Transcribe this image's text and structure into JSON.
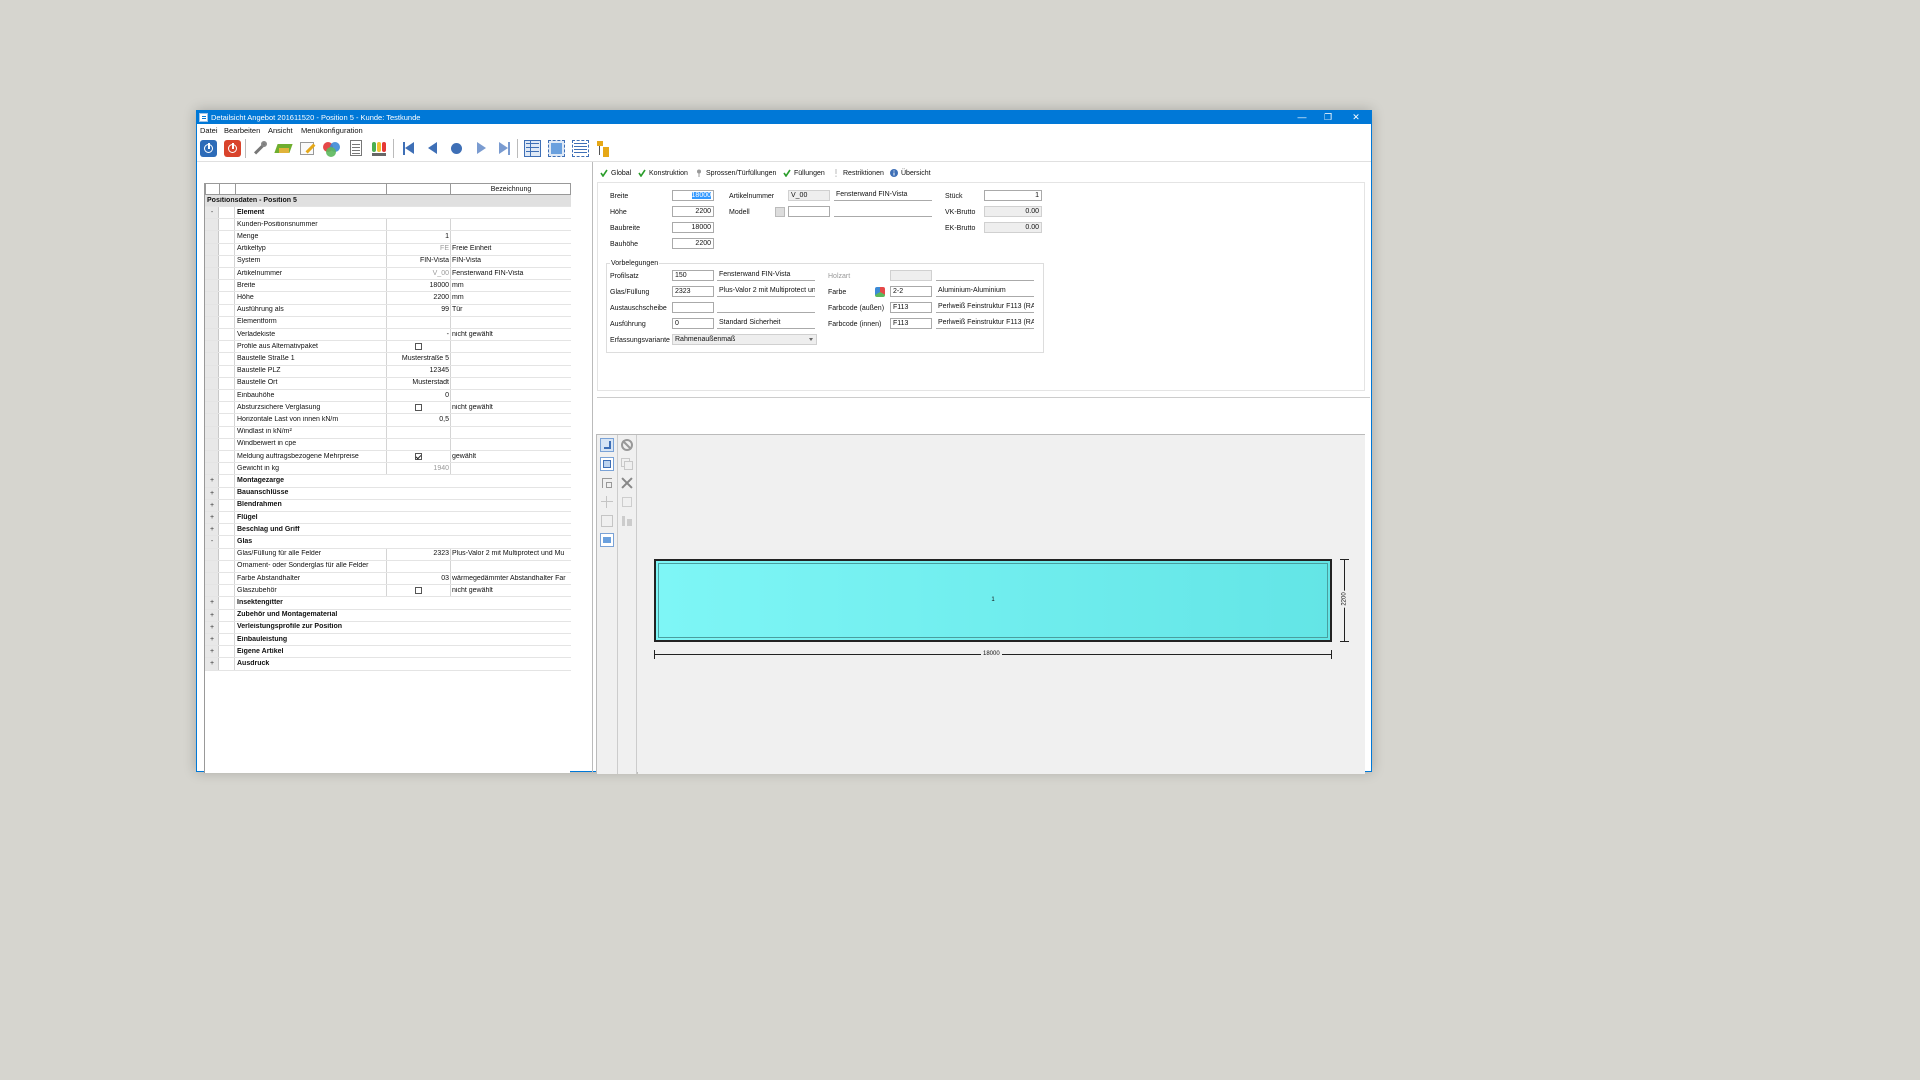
{
  "window": {
    "title": "Detailsicht Angebot 201611520 - Position 5 - Kunde: Testkunde",
    "min": "—",
    "restore": "❐",
    "close": "✕"
  },
  "menu": [
    "Datei",
    "Bearbeiten",
    "Ansicht",
    "Menükonfiguration"
  ],
  "toolbar": {
    "icons": [
      "power-blue-icon",
      "power-red-icon",
      "tools-icon",
      "arrow-green-icon",
      "pencil-icon",
      "palette-icon",
      "document-icon",
      "traffic-light-icon",
      "first-record-icon",
      "previous-record-icon",
      "current-record-icon",
      "next-record-icon",
      "last-record-icon",
      "grid-view-icon",
      "window-view-icon",
      "table-view-icon",
      "tree-view-icon"
    ]
  },
  "grid": {
    "header_bezeichnung": "Bezeichnung",
    "section_title": "Positionsdaten - Position 5",
    "rows": [
      {
        "pm": "-",
        "name": "Element",
        "value": "",
        "desc": "",
        "group": true
      },
      {
        "pm": "",
        "name": "Kunden-Positionsnummer",
        "value": "",
        "desc": ""
      },
      {
        "pm": "",
        "name": "Menge",
        "value": "1",
        "desc": ""
      },
      {
        "pm": "",
        "name": "Artikeltyp",
        "value": "FE",
        "desc": "Freie Einheit",
        "grey": true
      },
      {
        "pm": "",
        "name": "System",
        "value": "FIN-Vista",
        "desc": "FIN-Vista"
      },
      {
        "pm": "",
        "name": "Artikelnummer",
        "value": "V_00",
        "desc": "Fensterwand FIN-Vista",
        "grey": true
      },
      {
        "pm": "",
        "name": "Breite",
        "value": "18000",
        "desc": "mm"
      },
      {
        "pm": "",
        "name": "Höhe",
        "value": "2200",
        "desc": "mm"
      },
      {
        "pm": "",
        "name": "Ausführung als",
        "value": "99",
        "desc": "Tür"
      },
      {
        "pm": "",
        "name": "Elementform",
        "value": "",
        "desc": ""
      },
      {
        "pm": "",
        "name": "Verladekiste",
        "value": "-",
        "desc": "nicht gewählt"
      },
      {
        "pm": "",
        "name": "Profile aus Alternativpaket",
        "value": "",
        "desc": "",
        "check": "off"
      },
      {
        "pm": "",
        "name": "Baustelle Straße 1",
        "value": "Musterstraße 5",
        "desc": ""
      },
      {
        "pm": "",
        "name": "Baustelle PLZ",
        "value": "12345",
        "desc": ""
      },
      {
        "pm": "",
        "name": "Baustelle Ort",
        "value": "Musterstadt",
        "desc": ""
      },
      {
        "pm": "",
        "name": "Einbauhöhe",
        "value": "0",
        "desc": ""
      },
      {
        "pm": "",
        "name": "Absturzsichere Verglasung",
        "value": "",
        "desc": "nicht gewählt",
        "check": "off"
      },
      {
        "pm": "",
        "name": "Horizontale Last von innen kN/m",
        "value": "0,5",
        "desc": ""
      },
      {
        "pm": "",
        "name": "Windlast in kN/m²",
        "value": "",
        "desc": ""
      },
      {
        "pm": "",
        "name": "Windbeiwert in cpe",
        "value": "",
        "desc": ""
      },
      {
        "pm": "",
        "name": "Meldung auftragsbezogene Mehrpreise",
        "value": "",
        "desc": "gewählt",
        "check": "on"
      },
      {
        "pm": "",
        "name": "Gewicht in kg",
        "value": "1940",
        "desc": "",
        "grey": true
      },
      {
        "pm": "+",
        "name": "Montagezarge",
        "value": "",
        "desc": "",
        "group": true
      },
      {
        "pm": "+",
        "name": "Bauanschlüsse",
        "value": "",
        "desc": "",
        "group": true
      },
      {
        "pm": "+",
        "name": "Blendrahmen",
        "value": "",
        "desc": "",
        "group": true
      },
      {
        "pm": "+",
        "name": "Flügel",
        "value": "",
        "desc": "",
        "group": true
      },
      {
        "pm": "+",
        "name": "Beschlag und Griff",
        "value": "",
        "desc": "",
        "group": true
      },
      {
        "pm": "-",
        "name": "Glas",
        "value": "",
        "desc": "",
        "group": true
      },
      {
        "pm": "",
        "name": "Glas/Füllung für alle Felder",
        "value": "2323",
        "desc": "Plus-Valor 2 mit Multiprotect und Mu"
      },
      {
        "pm": "",
        "name": "Ornament- oder Sonderglas für alle Felder",
        "value": "",
        "desc": ""
      },
      {
        "pm": "",
        "name": "Farbe Abstandhalter",
        "value": "03",
        "desc": "wärmegedämmter Abstandhalter Far"
      },
      {
        "pm": "",
        "name": "Glaszubehör",
        "value": "",
        "desc": "nicht gewählt",
        "check": "off"
      },
      {
        "pm": "+",
        "name": "Insektengitter",
        "value": "",
        "desc": "",
        "group": true
      },
      {
        "pm": "+",
        "name": "Zubehör und Montagematerial",
        "value": "",
        "desc": "",
        "group": true
      },
      {
        "pm": "+",
        "name": "Verleistungsprofile zur Position",
        "value": "",
        "desc": "",
        "group": true
      },
      {
        "pm": "+",
        "name": "Einbauleistung",
        "value": "",
        "desc": "",
        "group": true
      },
      {
        "pm": "+",
        "name": "Eigene Artikel",
        "value": "",
        "desc": "",
        "group": true
      },
      {
        "pm": "+",
        "name": "Ausdruck",
        "value": "",
        "desc": "",
        "group": true
      }
    ]
  },
  "tabs": [
    {
      "label": "Global",
      "icon": "check-icon"
    },
    {
      "label": "Konstruktion",
      "icon": "check-icon"
    },
    {
      "label": "Sprossen/Türfüllungen",
      "icon": "pin-icon"
    },
    {
      "label": "Füllungen",
      "icon": "check-icon"
    },
    {
      "label": "Restriktionen",
      "icon": "exclamation-icon"
    },
    {
      "label": "Übersicht",
      "icon": "info-icon"
    }
  ],
  "form": {
    "breite_label": "Breite",
    "breite": "18000",
    "hoehe_label": "Höhe",
    "hoehe": "2200",
    "baubreite_label": "Baubreite",
    "baubreite": "18000",
    "bauhoehe_label": "Bauhöhe",
    "bauhoehe": "2200",
    "artikelnummer_label": "Artikelnummer",
    "artikelnummer": "V_00",
    "artikel_desc": "Fensterwand FIN-Vista",
    "modell_label": "Modell",
    "modell": "",
    "modell_desc": "",
    "stueck_label": "Stück",
    "stueck": "1",
    "vk_label": "VK-Brutto",
    "vk": "0.00",
    "ek_label": "EK-Brutto",
    "ek": "0.00",
    "vorbelegungen_label": "Vorbelegungen",
    "profilsatz_label": "Profilsatz",
    "profilsatz": "150",
    "profilsatz_desc": "Fensterwand FIN-Vista",
    "glas_label": "Glas/Füllung",
    "glas": "2323",
    "glas_desc": "Plus-Valor 2 mit Multiprotect und M",
    "austausch_label": "Austauschscheibe",
    "austausch": "",
    "austausch_desc": "",
    "ausfuehrung_label": "Ausführung",
    "ausfuehrung": "0",
    "ausfuehrung_desc": "Standard Sicherheit",
    "erfassung_label": "Erfassungsvariante",
    "erfassung": "Rahmenaußenmaß",
    "holzart_label": "Holzart",
    "holzart": "",
    "holzart_desc": "",
    "farbe_label": "Farbe",
    "farbe": "2-2",
    "farbe_desc": "Aluminium-Aluminium",
    "farbcode_aussen_label": "Farbcode (außen)",
    "farbcode_aussen": "F113",
    "farbcode_aussen_desc": "Perlweiß Feinstruktur F113 (RAL",
    "farbcode_innen_label": "Farbcode (innen)",
    "farbcode_innen": "F113",
    "farbcode_innen_desc": "Perlweiß Feinstruktur F113 (RAL"
  },
  "drawing": {
    "field_number": "1",
    "width_dim": "18000",
    "height_dim": "2200",
    "glass_color": "#6eeeee"
  },
  "colors": {
    "titlebar": "#0078d7",
    "accent_check": "#2a9d2a"
  }
}
